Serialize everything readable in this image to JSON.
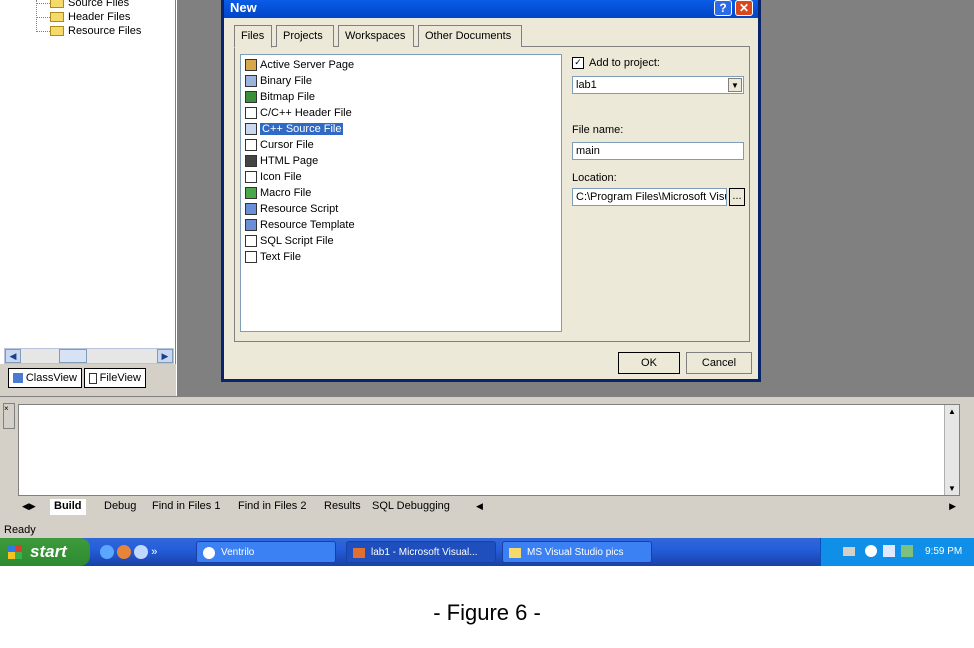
{
  "workspace": {
    "tree": [
      "Source Files",
      "Header Files",
      "Resource Files"
    ],
    "tabs": [
      "ClassView",
      "FileView"
    ]
  },
  "dialog": {
    "title": "New",
    "tabs": [
      "Files",
      "Projects",
      "Workspaces",
      "Other Documents"
    ],
    "file_types": [
      "Active Server Page",
      "Binary File",
      "Bitmap File",
      "C/C++ Header File",
      "C++ Source File",
      "Cursor File",
      "HTML Page",
      "Icon File",
      "Macro File",
      "Resource Script",
      "Resource Template",
      "SQL Script File",
      "Text File"
    ],
    "selected_file_type": "C++ Source File",
    "add_to_project_label": "Add to project:",
    "add_to_project_checked": true,
    "project_value": "lab1",
    "file_name_label": "File name:",
    "file_name_value": "main",
    "location_label": "Location:",
    "location_value": "C:\\Program Files\\Microsoft Visua",
    "browse_label": "...",
    "ok_label": "OK",
    "cancel_label": "Cancel"
  },
  "output": {
    "tabs": [
      "Build",
      "Debug",
      "Find in Files 1",
      "Find in Files 2",
      "Results",
      "SQL Debugging"
    ]
  },
  "status_text": "Ready",
  "taskbar": {
    "start_label": "start",
    "items": [
      "Ventrilo",
      "lab1 - Microsoft Visual...",
      "MS Visual Studio pics"
    ],
    "clock": "9:59 PM"
  },
  "caption": "- Figure 6 -",
  "colors": {
    "titlebar": "#0a5ce6",
    "selection": "#316ac5",
    "taskbar": "#245edb",
    "start": "#2f8a2f"
  }
}
